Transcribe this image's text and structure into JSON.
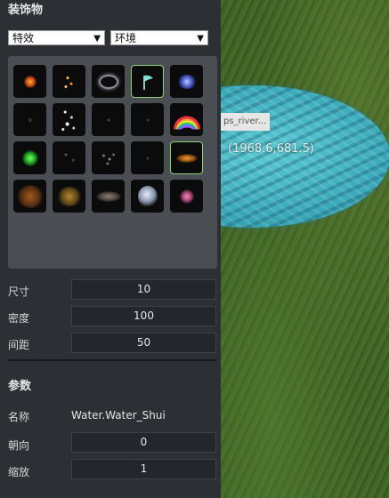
{
  "panel": {
    "title": "装饰物",
    "selects": [
      {
        "value": "特效"
      },
      {
        "value": "环境"
      }
    ],
    "thumbnails": [
      {
        "name": "fire-effect-thumb",
        "selected": false
      },
      {
        "name": "sparks-effect-thumb",
        "selected": false
      },
      {
        "name": "swirl-effect-thumb",
        "selected": false
      },
      {
        "name": "flag-effect-thumb",
        "selected": true
      },
      {
        "name": "blue-burst-effect-thumb",
        "selected": false
      },
      {
        "name": "dark-effect-thumb",
        "selected": false
      },
      {
        "name": "snow-effect-thumb",
        "selected": false
      },
      {
        "name": "faint-effect-thumb",
        "selected": false
      },
      {
        "name": "faint-effect-thumb-2",
        "selected": false
      },
      {
        "name": "rainbow-effect-thumb",
        "selected": false
      },
      {
        "name": "green-glow-effect-thumb",
        "selected": false
      },
      {
        "name": "dim-dots-effect-thumb",
        "selected": false
      },
      {
        "name": "particles-effect-thumb",
        "selected": false
      },
      {
        "name": "dark-effect-thumb-2",
        "selected": false
      },
      {
        "name": "orange-wisp-effect-thumb",
        "selected": true
      },
      {
        "name": "smoke-orange-effect-thumb",
        "selected": false
      },
      {
        "name": "golden-dust-effect-thumb",
        "selected": false
      },
      {
        "name": "grey-cloud-effect-thumb",
        "selected": false
      },
      {
        "name": "white-cloud-effect-thumb",
        "selected": false
      },
      {
        "name": "pink-flower-effect-thumb",
        "selected": false
      }
    ],
    "size_label": "尺寸",
    "size_value": "10",
    "density_label": "密度",
    "density_value": "100",
    "spacing_label": "间距",
    "spacing_value": "50"
  },
  "params": {
    "title": "参数",
    "name_label": "名称",
    "name_value": "Water.Water_Shui",
    "orient_label": "朝向",
    "orient_value": "0",
    "scale_label": "缩放",
    "scale_value": "1"
  },
  "viewport": {
    "tooltip_text": "ps_river...",
    "coordinate": "(1968.6,681.5)"
  },
  "colors": {
    "panel_bg": "#2c2f33",
    "grid_bg": "#4a4d52",
    "selected_border": "#8fd27d",
    "water": "#3aa8b8",
    "grass": "#3e5e25"
  }
}
